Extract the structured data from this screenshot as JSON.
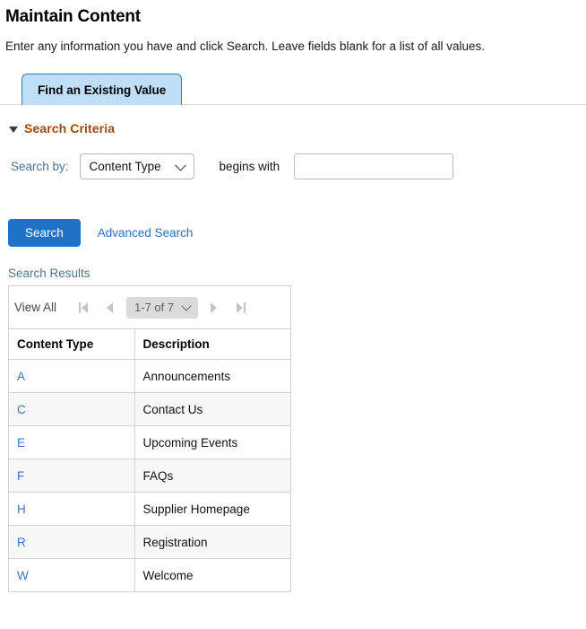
{
  "page": {
    "title": "Maintain Content",
    "instructions": "Enter any information you have and click Search. Leave fields blank for a list of all values."
  },
  "tabs": [
    {
      "label": "Find an Existing Value",
      "active": true
    }
  ],
  "search_criteria": {
    "section_title": "Search Criteria",
    "collapse_icon": "triangle-down-icon",
    "search_by_label": "Search by:",
    "search_by_value": "Content Type",
    "search_by_options": [
      "Content Type"
    ],
    "operator_label": "begins with",
    "search_value": "",
    "search_placeholder": ""
  },
  "actions": {
    "search_label": "Search",
    "advanced_search_label": "Advanced Search"
  },
  "results": {
    "label": "Search Results",
    "view_all_label": "View All",
    "pager": {
      "first_icon": "first-page-icon",
      "prev_icon": "previous-page-icon",
      "range_label": "1-7 of 7",
      "range_chevron_icon": "chevron-down-icon",
      "next_icon": "next-page-icon",
      "last_icon": "last-page-icon"
    },
    "columns": [
      "Content Type",
      "Description"
    ],
    "rows": [
      {
        "content_type": "A",
        "description": "Announcements"
      },
      {
        "content_type": "C",
        "description": "Contact Us"
      },
      {
        "content_type": "E",
        "description": "Upcoming Events"
      },
      {
        "content_type": "F",
        "description": "FAQs"
      },
      {
        "content_type": "H",
        "description": "Supplier Homepage"
      },
      {
        "content_type": "R",
        "description": "Registration"
      },
      {
        "content_type": "W",
        "description": "Welcome"
      }
    ]
  },
  "colors": {
    "tab_fill": "#bfdef7",
    "tab_border": "#2d7dc4",
    "section_title": "#9c4a12",
    "label_blue": "#4a7296",
    "link_blue": "#2a6fc9",
    "button_blue": "#1f72c8",
    "pager_pill": "#d9dbdc",
    "row_alt": "#f7f7f7",
    "border_gray": "#d0d2d4"
  }
}
